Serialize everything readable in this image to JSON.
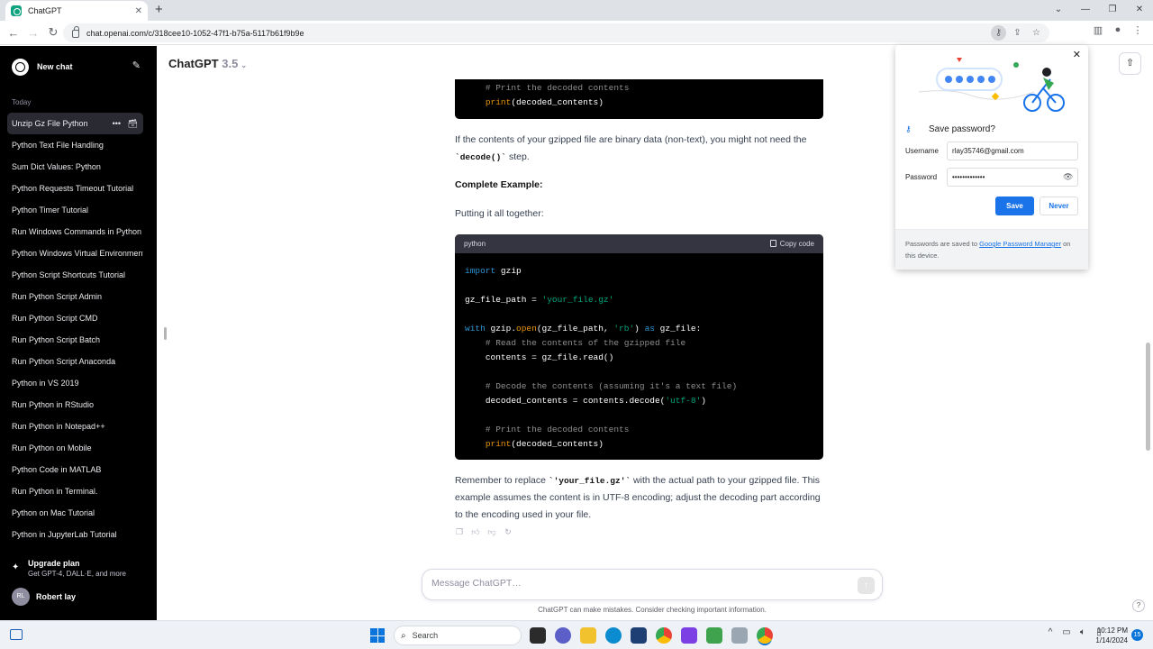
{
  "browser": {
    "tab_title": "ChatGPT",
    "url": "chat.openai.com/c/318cee10-1052-47f1-b75a-5117b61f9b9e"
  },
  "sidebar": {
    "new_chat": "New chat",
    "section_label": "Today",
    "items": [
      "Unzip Gz File Python",
      "Python Text File Handling",
      "Sum Dict Values: Python",
      "Python Requests Timeout Tutorial",
      "Python Timer Tutorial",
      "Run Windows Commands in Python",
      "Python Windows Virtual Environment",
      "Python Script Shortcuts Tutorial",
      "Run Python Script Admin",
      "Run Python Script CMD",
      "Run Python Script Batch",
      "Run Python Script Anaconda",
      "Python in VS 2019",
      "Run Python in RStudio",
      "Run Python in Notepad++",
      "Run Python on Mobile",
      "Python Code in MATLAB",
      "Run Python in Terminal.",
      "Python on Mac Tutorial",
      "Python in JupyterLab Tutorial"
    ],
    "upgrade_title": "Upgrade plan",
    "upgrade_sub": "Get GPT-4, DALL·E, and more",
    "user_initials": "RL",
    "user_name": "Robert lay"
  },
  "header": {
    "model": "ChatGPT",
    "version": "3.5"
  },
  "message": {
    "para_binary": "If the contents of your gzipped file are binary data (non-text), you might not need the",
    "decode_code": "`decode()`",
    "para_binary_end": "step.",
    "complete_heading": "Complete Example:",
    "putting_together": "Putting it all together:",
    "code_lang": "python",
    "copy_label": "Copy code",
    "remember_pre": "Remember to replace",
    "remember_code": "`'your_file.gz'`",
    "remember_post": "with the actual path to your gzipped file. This example assumes the content is in UTF-8 encoding; adjust the decoding part according to the encoding used in your file."
  },
  "code_top": {
    "comment": "# Print the decoded contents",
    "print_fn": "print",
    "print_arg": "(decoded_contents)"
  },
  "code": {
    "l1_kw": "import",
    "l1_rest": " gzip",
    "l3_var": "gz_file_path = ",
    "l3_str": "'your_file.gz'",
    "l5_kw": "with",
    "l5_a": " gzip.",
    "l5_fn": "open",
    "l5_b": "(gz_file_path, ",
    "l5_str": "'rb'",
    "l5_c": ") ",
    "l5_kw2": "as",
    "l5_d": " gz_file:",
    "l6_cm": "# Read the contents of the gzipped file",
    "l7": "contents = gz_file.read()",
    "l9_cm": "# Decode the contents (assuming it's a text file)",
    "l10_a": "decoded_contents = contents.decode(",
    "l10_str": "'utf-8'",
    "l10_b": ")",
    "l12_cm": "# Print the decoded contents",
    "l13_fn": "print",
    "l13_rest": "(decoded_contents)"
  },
  "composer": {
    "placeholder": "Message ChatGPT…",
    "disclaimer": "ChatGPT can make mistakes. Consider checking important information."
  },
  "password_popup": {
    "title": "Save password?",
    "username_label": "Username",
    "username_value": "rlay35746@gmail.com",
    "password_label": "Password",
    "password_value": "•••••••••••••",
    "save": "Save",
    "never": "Never",
    "footer_pre": "Passwords are saved to",
    "footer_link": "Google Password Manager",
    "footer_post": "on this device."
  },
  "taskbar": {
    "search": "Search",
    "time": "10:12 PM",
    "date": "1/14/2024",
    "notifications": "15"
  },
  "colors": {
    "sidebar_bg": "#000000",
    "accent_blue": "#1a73e8",
    "code_bg": "#000000"
  }
}
